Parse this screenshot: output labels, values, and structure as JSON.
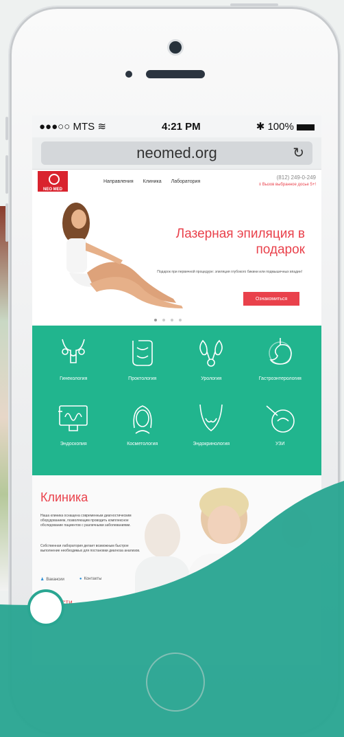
{
  "status": {
    "carrier": "●●●○○ MTS",
    "wifi": "wifi-icon",
    "time": "4:21 PM",
    "battery": "100%"
  },
  "browser": {
    "url": "neomed.org"
  },
  "site": {
    "nav": [
      "Направления",
      "Клиника",
      "Лаборатория"
    ],
    "phone": "(812) 249-0-249",
    "phone_sub": "≡ Вызов выбранное досье 5+!",
    "hero": {
      "title": "Лазерная эпиляция в подарок",
      "text": "Подарок при первичной процедуре: эпиляция глубокого бикини или подмышечных впадин!",
      "button": "Ознакомиться"
    },
    "services": [
      "Гинекология",
      "Проктология",
      "Урология",
      "Гастроэнтерология",
      "Эндоскопия",
      "Косметология",
      "Эндокринология",
      "УЗИ"
    ],
    "clinic": {
      "title": "Клиника",
      "p1": "Наша клиника оснащена современным диагностическим оборудованием, позволяющим проводить комплексное обследование пациентов с различными заболеваниями.",
      "p2": "Собственная лаборатория делает возможным быстрое выполнение необходимых для постановки диагноза анализов.",
      "link_vacancies": "Вакансии",
      "link_contacts": "Контакты",
      "news": "Новости"
    }
  },
  "colors": {
    "accent": "#e9414b",
    "teal": "#21b58e",
    "wave": "#2aa692"
  }
}
